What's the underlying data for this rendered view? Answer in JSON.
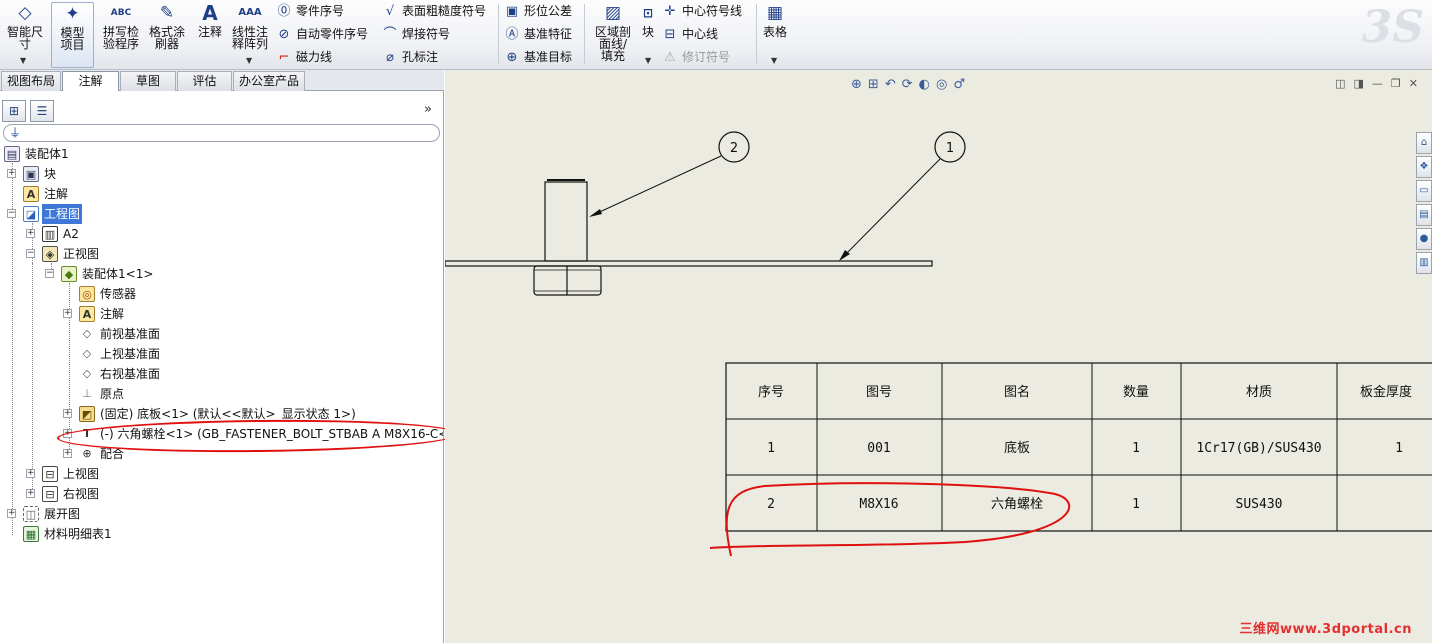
{
  "ribbon": {
    "smart_dimension": "智能尺寸",
    "model_items": "模型项目",
    "spell_checker": "拼写检验程序",
    "format_painter": "格式涂刷器",
    "note": "注释",
    "linear_note_pattern": "线性注释阵列",
    "balloon": "零件序号",
    "auto_balloon": "自动零件序号",
    "magnetic_line": "磁力线",
    "surface_finish": "表面粗糙度符号",
    "weld_symbol": "焊接符号",
    "hole_callout": "孔标注",
    "geometric_tolerance": "形位公差",
    "datum_feature": "基准特征",
    "datum_target": "基准目标",
    "area_hatch": "区域剖面线/填充",
    "block": "块",
    "center_mark": "中心符号线",
    "centerline": "中心线",
    "revision_symbol": "修订符号",
    "table": "表格",
    "icon_abc": "ABC"
  },
  "tabs": [
    "视图布局",
    "注解",
    "草图",
    "评估",
    "办公室产品"
  ],
  "active_tab": "注解",
  "tree": {
    "root": "装配体1",
    "items": [
      {
        "label": "块"
      },
      {
        "label": "注解"
      },
      {
        "label": "工程图"
      },
      {
        "label": "A2"
      },
      {
        "label": "正视图"
      },
      {
        "label": "装配体1<1>"
      },
      {
        "label": "传感器"
      },
      {
        "label": "注解"
      },
      {
        "label": "前视基准面"
      },
      {
        "label": "上视基准面"
      },
      {
        "label": "右视基准面"
      },
      {
        "label": "原点"
      },
      {
        "label": "(固定) 底板<1> (默认<<默认>_显示状态 1>)"
      },
      {
        "label": "(-) 六角螺栓<1> (GB_FASTENER_BOLT_STBAB A M8X16-C<"
      },
      {
        "label": "配合"
      },
      {
        "label": "上视图"
      },
      {
        "label": "右视图"
      },
      {
        "label": "展开图"
      },
      {
        "label": "材料明细表1"
      }
    ]
  },
  "balloons": [
    "2",
    "1"
  ],
  "bom": {
    "headers": [
      "序号",
      "图号",
      "图名",
      "数量",
      "材质",
      "板金厚度"
    ],
    "rows": [
      [
        "1",
        "001",
        "底板",
        "1",
        "1Cr17(GB)/SUS430",
        "1"
      ],
      [
        "2",
        "M8X16",
        "六角螺栓",
        "1",
        "SUS430",
        ""
      ]
    ]
  },
  "watermark": "三维网www.3dportal.cn",
  "colors": {
    "selection": "#3d78d8",
    "annotation_red": "#e01010",
    "canvas": "#ecebe1"
  }
}
